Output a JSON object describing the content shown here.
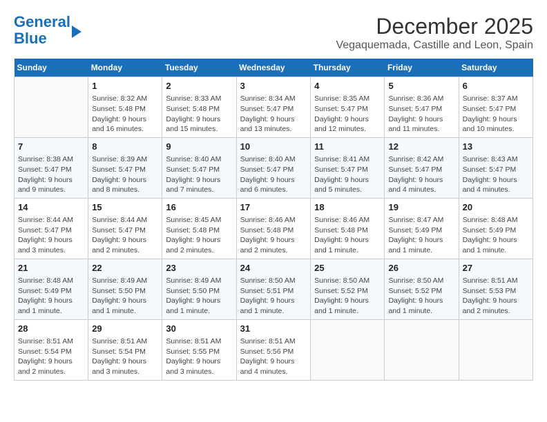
{
  "logo": {
    "line1": "General",
    "line2": "Blue"
  },
  "title": "December 2025",
  "location": "Vegaquemada, Castille and Leon, Spain",
  "days_of_week": [
    "Sunday",
    "Monday",
    "Tuesday",
    "Wednesday",
    "Thursday",
    "Friday",
    "Saturday"
  ],
  "weeks": [
    [
      {
        "day": "",
        "info": ""
      },
      {
        "day": "1",
        "info": "Sunrise: 8:32 AM\nSunset: 5:48 PM\nDaylight: 9 hours\nand 16 minutes."
      },
      {
        "day": "2",
        "info": "Sunrise: 8:33 AM\nSunset: 5:48 PM\nDaylight: 9 hours\nand 15 minutes."
      },
      {
        "day": "3",
        "info": "Sunrise: 8:34 AM\nSunset: 5:47 PM\nDaylight: 9 hours\nand 13 minutes."
      },
      {
        "day": "4",
        "info": "Sunrise: 8:35 AM\nSunset: 5:47 PM\nDaylight: 9 hours\nand 12 minutes."
      },
      {
        "day": "5",
        "info": "Sunrise: 8:36 AM\nSunset: 5:47 PM\nDaylight: 9 hours\nand 11 minutes."
      },
      {
        "day": "6",
        "info": "Sunrise: 8:37 AM\nSunset: 5:47 PM\nDaylight: 9 hours\nand 10 minutes."
      }
    ],
    [
      {
        "day": "7",
        "info": "Sunrise: 8:38 AM\nSunset: 5:47 PM\nDaylight: 9 hours\nand 9 minutes."
      },
      {
        "day": "8",
        "info": "Sunrise: 8:39 AM\nSunset: 5:47 PM\nDaylight: 9 hours\nand 8 minutes."
      },
      {
        "day": "9",
        "info": "Sunrise: 8:40 AM\nSunset: 5:47 PM\nDaylight: 9 hours\nand 7 minutes."
      },
      {
        "day": "10",
        "info": "Sunrise: 8:40 AM\nSunset: 5:47 PM\nDaylight: 9 hours\nand 6 minutes."
      },
      {
        "day": "11",
        "info": "Sunrise: 8:41 AM\nSunset: 5:47 PM\nDaylight: 9 hours\nand 5 minutes."
      },
      {
        "day": "12",
        "info": "Sunrise: 8:42 AM\nSunset: 5:47 PM\nDaylight: 9 hours\nand 4 minutes."
      },
      {
        "day": "13",
        "info": "Sunrise: 8:43 AM\nSunset: 5:47 PM\nDaylight: 9 hours\nand 4 minutes."
      }
    ],
    [
      {
        "day": "14",
        "info": "Sunrise: 8:44 AM\nSunset: 5:47 PM\nDaylight: 9 hours\nand 3 minutes."
      },
      {
        "day": "15",
        "info": "Sunrise: 8:44 AM\nSunset: 5:47 PM\nDaylight: 9 hours\nand 2 minutes."
      },
      {
        "day": "16",
        "info": "Sunrise: 8:45 AM\nSunset: 5:48 PM\nDaylight: 9 hours\nand 2 minutes."
      },
      {
        "day": "17",
        "info": "Sunrise: 8:46 AM\nSunset: 5:48 PM\nDaylight: 9 hours\nand 2 minutes."
      },
      {
        "day": "18",
        "info": "Sunrise: 8:46 AM\nSunset: 5:48 PM\nDaylight: 9 hours\nand 1 minute."
      },
      {
        "day": "19",
        "info": "Sunrise: 8:47 AM\nSunset: 5:49 PM\nDaylight: 9 hours\nand 1 minute."
      },
      {
        "day": "20",
        "info": "Sunrise: 8:48 AM\nSunset: 5:49 PM\nDaylight: 9 hours\nand 1 minute."
      }
    ],
    [
      {
        "day": "21",
        "info": "Sunrise: 8:48 AM\nSunset: 5:49 PM\nDaylight: 9 hours\nand 1 minute."
      },
      {
        "day": "22",
        "info": "Sunrise: 8:49 AM\nSunset: 5:50 PM\nDaylight: 9 hours\nand 1 minute."
      },
      {
        "day": "23",
        "info": "Sunrise: 8:49 AM\nSunset: 5:50 PM\nDaylight: 9 hours\nand 1 minute."
      },
      {
        "day": "24",
        "info": "Sunrise: 8:50 AM\nSunset: 5:51 PM\nDaylight: 9 hours\nand 1 minute."
      },
      {
        "day": "25",
        "info": "Sunrise: 8:50 AM\nSunset: 5:52 PM\nDaylight: 9 hours\nand 1 minute."
      },
      {
        "day": "26",
        "info": "Sunrise: 8:50 AM\nSunset: 5:52 PM\nDaylight: 9 hours\nand 1 minute."
      },
      {
        "day": "27",
        "info": "Sunrise: 8:51 AM\nSunset: 5:53 PM\nDaylight: 9 hours\nand 2 minutes."
      }
    ],
    [
      {
        "day": "28",
        "info": "Sunrise: 8:51 AM\nSunset: 5:54 PM\nDaylight: 9 hours\nand 2 minutes."
      },
      {
        "day": "29",
        "info": "Sunrise: 8:51 AM\nSunset: 5:54 PM\nDaylight: 9 hours\nand 3 minutes."
      },
      {
        "day": "30",
        "info": "Sunrise: 8:51 AM\nSunset: 5:55 PM\nDaylight: 9 hours\nand 3 minutes."
      },
      {
        "day": "31",
        "info": "Sunrise: 8:51 AM\nSunset: 5:56 PM\nDaylight: 9 hours\nand 4 minutes."
      },
      {
        "day": "",
        "info": ""
      },
      {
        "day": "",
        "info": ""
      },
      {
        "day": "",
        "info": ""
      }
    ]
  ]
}
